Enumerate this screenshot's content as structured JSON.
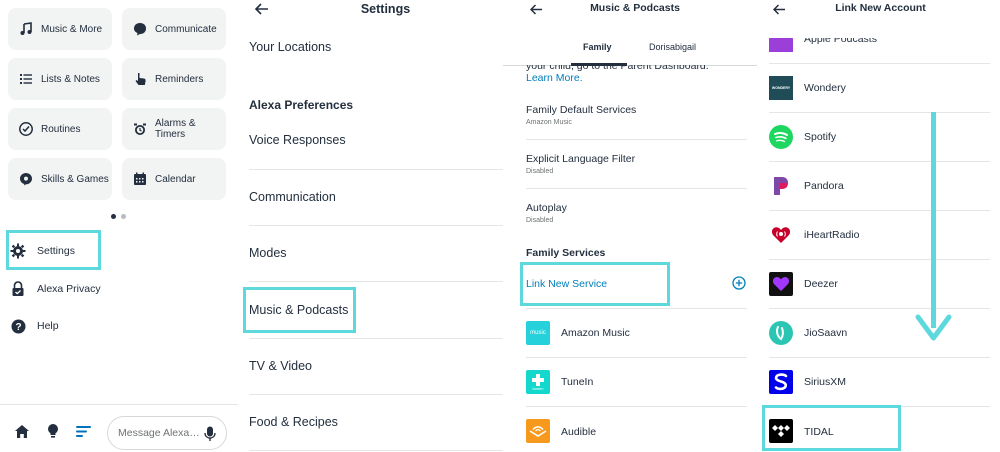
{
  "panel1": {
    "tiles": [
      {
        "label": "Music & More",
        "icon": "music-note-icon"
      },
      {
        "label": "Communicate",
        "icon": "speech-bubble-icon"
      },
      {
        "label": "Lists & Notes",
        "icon": "list-icon"
      },
      {
        "label": "Reminders",
        "icon": "hand-pointer-icon"
      },
      {
        "label": "Routines",
        "icon": "routines-icon"
      },
      {
        "label": "Alarms & Timers",
        "icon": "alarm-clock-icon"
      },
      {
        "label": "Skills & Games",
        "icon": "skills-icon"
      },
      {
        "label": "Calendar",
        "icon": "calendar-icon"
      }
    ],
    "menu": [
      {
        "label": "Settings",
        "icon": "gear-icon"
      },
      {
        "label": "Alexa Privacy",
        "icon": "lock-icon"
      },
      {
        "label": "Help",
        "icon": "help-icon"
      }
    ],
    "message_placeholder": "Message Alexa…"
  },
  "panel2": {
    "title": "Settings",
    "top_item": "Your Locations",
    "section": "Alexa Preferences",
    "items": [
      "Voice Responses",
      "Communication",
      "Modes",
      "Music & Podcasts",
      "TV & Video",
      "Food & Recipes"
    ]
  },
  "panel3": {
    "title": "Music & Podcasts",
    "tabs": [
      "Family",
      "Dorisabigail"
    ],
    "intro_cut": "your child, go to the Parent Dashboard.",
    "learn_more": "Learn More.",
    "settings": [
      {
        "label": "Family Default Services",
        "sub": "Amazon Music"
      },
      {
        "label": "Explicit Language Filter",
        "sub": "Disabled"
      },
      {
        "label": "Autoplay",
        "sub": "Disabled"
      }
    ],
    "section": "Family Services",
    "link_service": "Link New Service",
    "services": [
      {
        "name": "Amazon Music",
        "logo_text": "music"
      },
      {
        "name": "TuneIn",
        "logo_text": "tunein"
      },
      {
        "name": "Audible",
        "logo_text": ""
      }
    ]
  },
  "panel4": {
    "title": "Link New Account",
    "cut_item": "Apple Podcasts",
    "services": [
      {
        "name": "Wondery",
        "logo_text": "WONDERY"
      },
      {
        "name": "Spotify"
      },
      {
        "name": "Pandora"
      },
      {
        "name": "iHeartRadio"
      },
      {
        "name": "Deezer"
      },
      {
        "name": "JioSaavn"
      },
      {
        "name": "SiriusXM"
      },
      {
        "name": "TIDAL"
      }
    ]
  },
  "colors": {
    "highlight": "#5dd8dc",
    "link": "#007eb9",
    "text": "#232f3e",
    "tile_bg": "#f2f3f3"
  }
}
